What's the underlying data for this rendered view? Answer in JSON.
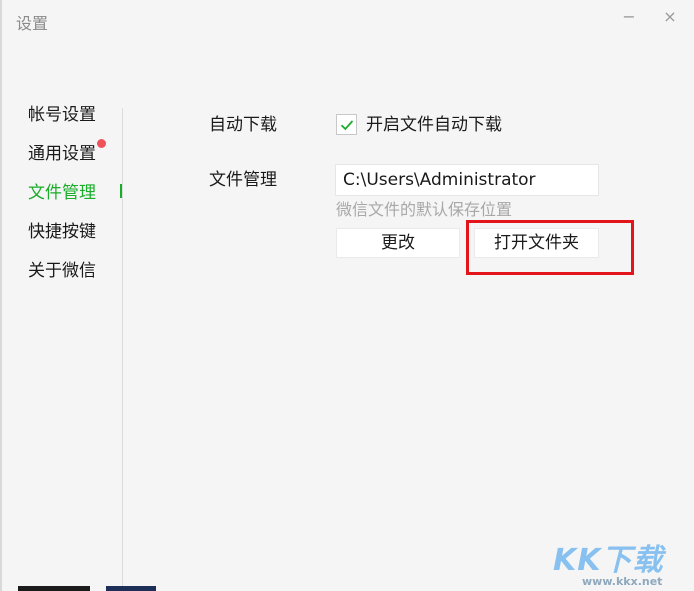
{
  "window": {
    "title": "设置",
    "minimize_glyph": "−",
    "close_glyph": "×"
  },
  "sidebar": {
    "items": [
      {
        "label": "帐号设置",
        "active": false,
        "badge": false
      },
      {
        "label": "通用设置",
        "active": false,
        "badge": true
      },
      {
        "label": "文件管理",
        "active": true,
        "badge": false
      },
      {
        "label": "快捷按键",
        "active": false,
        "badge": false
      },
      {
        "label": "关于微信",
        "active": false,
        "badge": false
      }
    ]
  },
  "main": {
    "auto_download": {
      "label": "自动下载",
      "checkbox_label": "开启文件自动下载",
      "checked": true
    },
    "file_management": {
      "label": "文件管理",
      "path_value": "C:\\Users\\Administrator",
      "hint": "微信文件的默认保存位置",
      "change_button": "更改",
      "open_folder_button": "打开文件夹"
    }
  },
  "annotation": {
    "highlight_color": "#e3141a",
    "highlighted_target": "打开文件夹"
  },
  "colors": {
    "accent": "#19ad2a",
    "badge": "#f0525a",
    "background": "#f5f5f5",
    "hint": "#a8a8a8"
  },
  "watermark": {
    "text": "KK下载",
    "url": "www.kkx.net"
  }
}
